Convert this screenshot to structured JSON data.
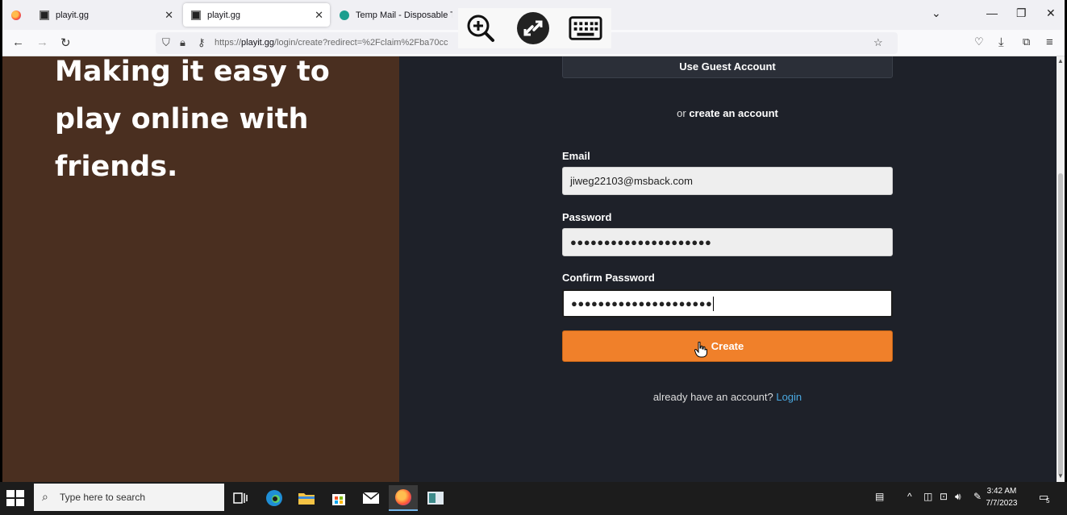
{
  "browser": {
    "tabs": [
      {
        "label": "playit.gg",
        "active": false
      },
      {
        "label": "playit.gg",
        "active": true
      },
      {
        "label": "Temp Mail - Disposable Tem",
        "active": false
      }
    ],
    "url_prefix": "https://",
    "url_domain": "playit.gg",
    "url_path": "/login/create?redirect=%2Fclaim%2Fba70cc"
  },
  "page": {
    "hero": "Making it easy to play online with friends.",
    "guest_button": "Use Guest Account",
    "or_text": "or",
    "create_account_text": "create an account",
    "email_label": "Email",
    "email_value": "jiweg22103@msback.com",
    "password_label": "Password",
    "password_value": "●●●●●●●●●●●●●●●●●●●●●",
    "confirm_label": "Confirm Password",
    "confirm_value": "●●●●●●●●●●●●●●●●●●●●●",
    "create_button": "Create",
    "already_text": "already have an account?",
    "login_link": "Login"
  },
  "taskbar": {
    "search_placeholder": "Type here to search",
    "time": "3:42 AM",
    "date": "7/7/2023",
    "notification_count": "5"
  },
  "colors": {
    "accent": "#f0802a",
    "link": "#4aa8e0",
    "hero_bg": "#4a2f20",
    "page_bg": "#1e2129"
  }
}
